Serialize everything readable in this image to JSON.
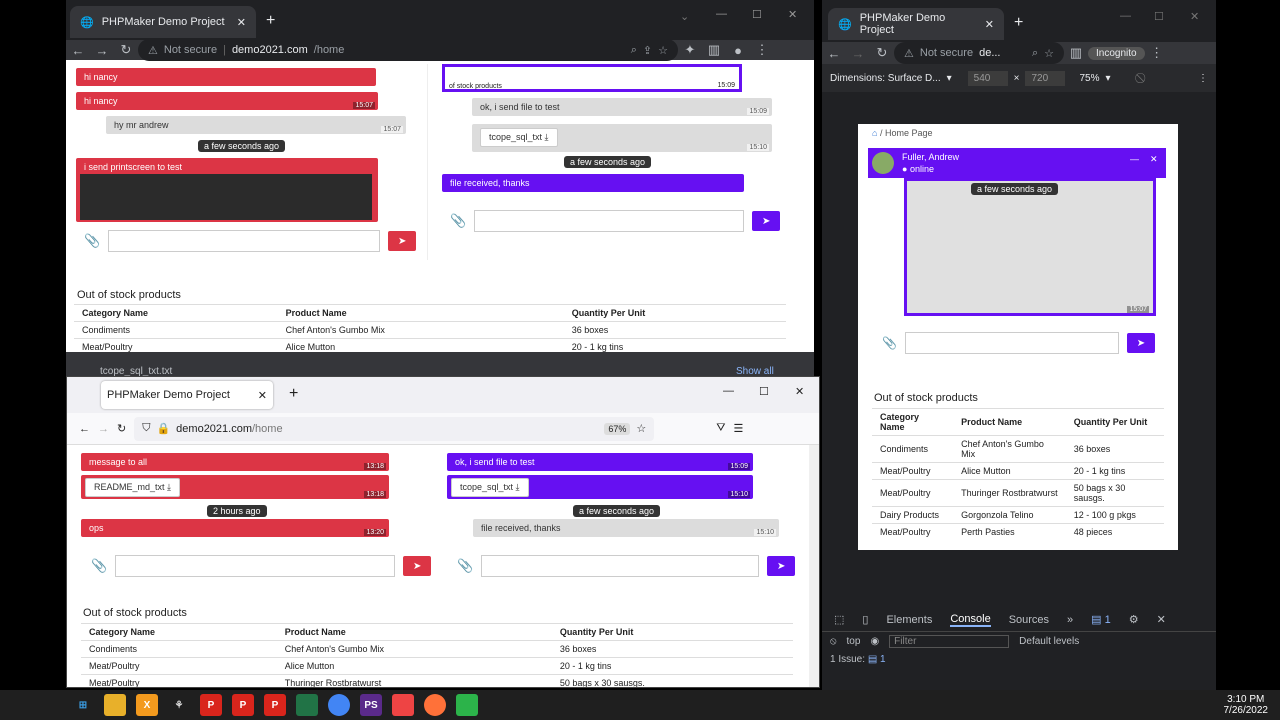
{
  "w1": {
    "tab_title": "PHPMaker Demo Project",
    "not_secure": "Not secure",
    "url_host": "demo2021.com",
    "url_path": "/home",
    "chat_left": {
      "messages": [
        {
          "text": "hi nancy",
          "time": ""
        },
        {
          "text": "hi nancy",
          "time": "15:07"
        },
        {
          "text": "hy mr andrew",
          "time": "15:07"
        },
        {
          "text": "i send printscreen to test",
          "time": ""
        }
      ],
      "separator": "a few seconds ago"
    },
    "chat_right": {
      "messages": [
        {
          "text": "ok, i send file to test",
          "time": "15:09"
        },
        {
          "text": "tcope_sql_txt",
          "time": "15:10"
        },
        {
          "text": "file received, thanks",
          "time": ""
        }
      ],
      "top_time": "15:09",
      "top_caption": "of stock products",
      "separator": "a few seconds ago"
    },
    "section_title": "Out of stock products",
    "table": {
      "headers": [
        "Category Name",
        "Product Name",
        "Quantity Per Unit"
      ],
      "rows": [
        [
          "Condiments",
          "Chef Anton's Gumbo Mix",
          "36 boxes"
        ],
        [
          "Meat/Poultry",
          "Alice Mutton",
          "20 - 1 kg tins"
        ]
      ]
    },
    "download": {
      "file": "tcope_sql_txt.txt",
      "show_all": "Show all"
    }
  },
  "w2": {
    "tab_title": "PHPMaker Demo Project",
    "url_host": "demo2021.com",
    "url_path": "/home",
    "zoom": "67%",
    "chat_left": {
      "messages": [
        {
          "text": "message to all",
          "time": "13:18"
        },
        {
          "text": "README_md_txt",
          "time": "13:18"
        },
        {
          "text": "ops",
          "time": "13:20"
        }
      ],
      "separator": "2 hours ago"
    },
    "chat_right": {
      "messages": [
        {
          "text": "ok, i send file to test",
          "time": "15:09"
        },
        {
          "text": "tcope_sql_txt",
          "time": "15:10"
        },
        {
          "text": "file received, thanks",
          "time": "15:10"
        }
      ],
      "separator": "a few seconds ago"
    },
    "section_title": "Out of stock products",
    "table": {
      "headers": [
        "Category Name",
        "Product Name",
        "Quantity Per Unit"
      ],
      "rows": [
        [
          "Condiments",
          "Chef Anton's Gumbo Mix",
          "36 boxes"
        ],
        [
          "Meat/Poultry",
          "Alice Mutton",
          "20 - 1 kg tins"
        ],
        [
          "Meat/Poultry",
          "Thuringer Rostbratwurst",
          "50 bags x 30 sausgs."
        ]
      ]
    }
  },
  "w3": {
    "tab_title": "PHPMaker Demo Project",
    "not_secure": "Not secure",
    "url_short": "de...",
    "incognito": "Incognito",
    "dimensions_label": "Dimensions: Surface D...",
    "width": "540",
    "height": "720",
    "zoom": "75%",
    "breadcrumb": "Home Page",
    "chat_user": "Fuller, Andrew",
    "chat_status": "online",
    "chat_separator": "a few seconds ago",
    "chat_time": "15:07",
    "section_title": "Out of stock products",
    "table": {
      "headers": [
        "Category Name",
        "Product Name",
        "Quantity Per Unit"
      ],
      "rows": [
        [
          "Condiments",
          "Chef Anton's Gumbo Mix",
          "36 boxes"
        ],
        [
          "Meat/Poultry",
          "Alice Mutton",
          "20 - 1 kg tins"
        ],
        [
          "Meat/Poultry",
          "Thuringer Rostbratwurst",
          "50 bags x 30 sausgs."
        ],
        [
          "Dairy Products",
          "Gorgonzola Telino",
          "12 - 100 g pkgs"
        ],
        [
          "Meat/Poultry",
          "Perth Pasties",
          "48 pieces"
        ]
      ]
    },
    "devtools": {
      "tabs": [
        "Elements",
        "Console",
        "Sources"
      ],
      "issues_badge": "1",
      "context": "top",
      "filter_placeholder": "Filter",
      "levels": "Default levels",
      "issue_line": "1 Issue:",
      "issue_count": "1"
    }
  },
  "taskbar": {
    "time": "3:10 PM",
    "date": "7/26/2022"
  }
}
